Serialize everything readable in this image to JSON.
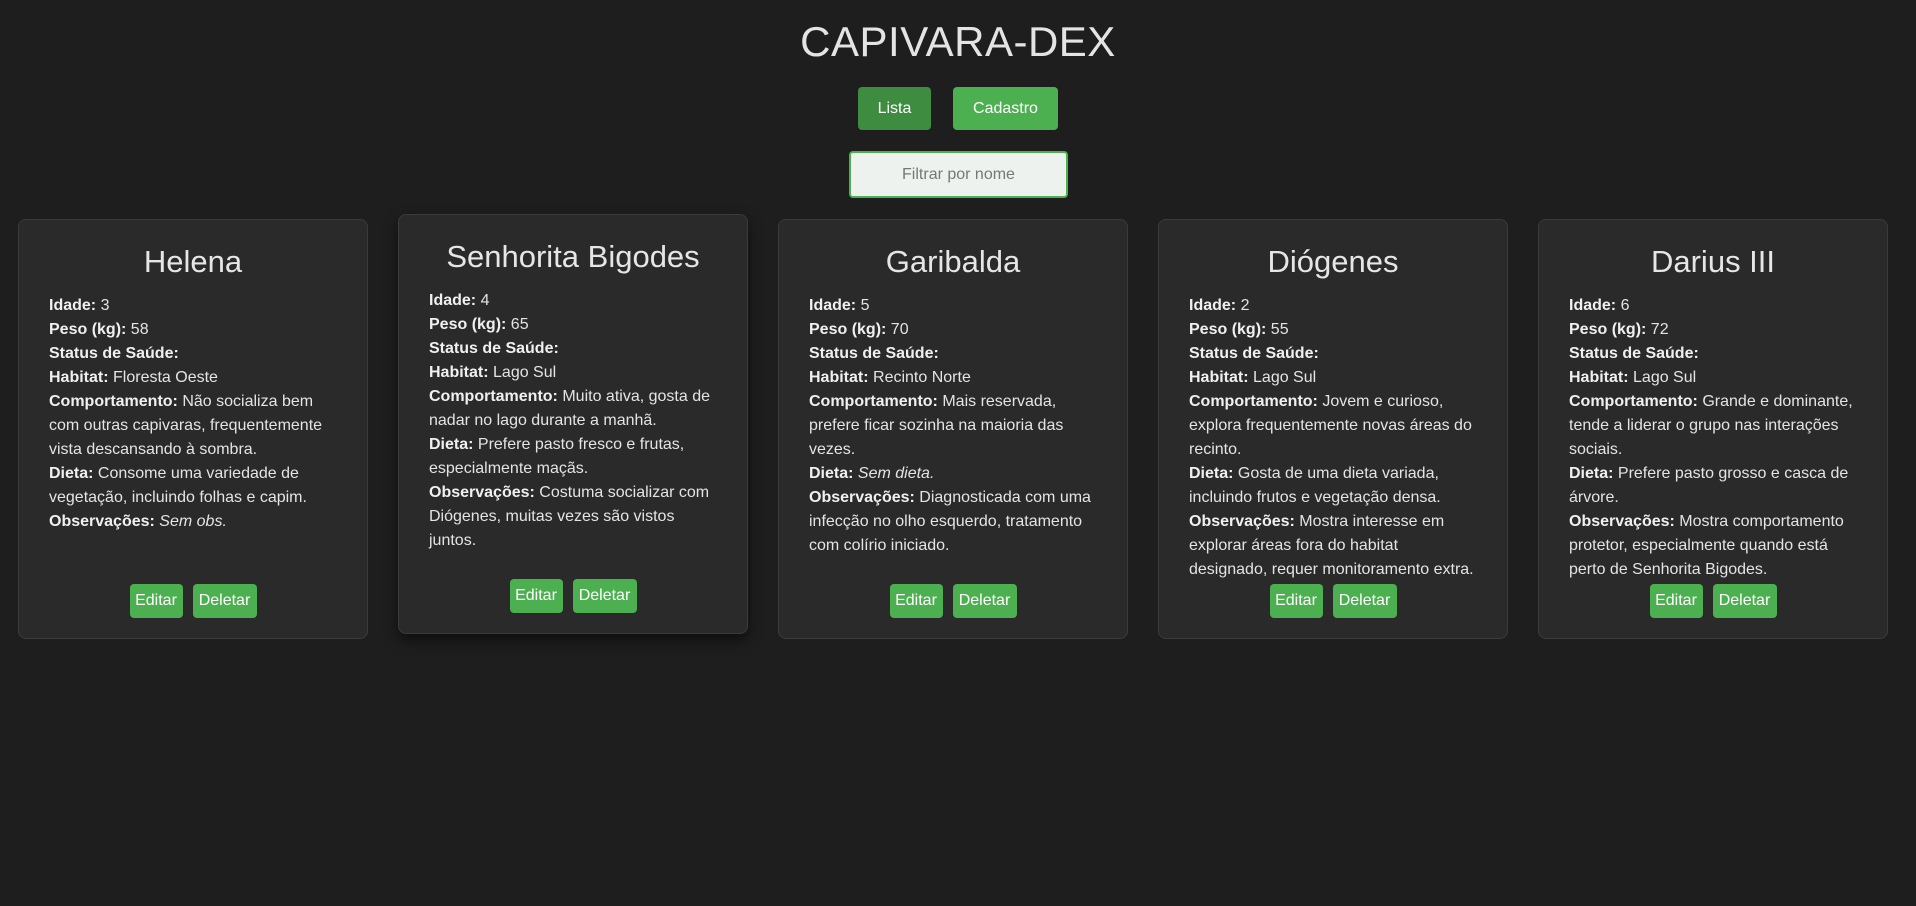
{
  "app": {
    "title": "CAPIVARA-DEX"
  },
  "nav": {
    "lista": "Lista",
    "cadastro": "Cadastro"
  },
  "filter": {
    "placeholder": "Filtrar por nome",
    "value": ""
  },
  "labels": {
    "idade": "Idade:",
    "peso": "Peso (kg):",
    "status": "Status de Saúde:",
    "habitat": "Habitat:",
    "comportamento": "Comportamento:",
    "dieta": "Dieta:",
    "observacoes": "Observações:",
    "edit": "Editar",
    "delete": "Deletar"
  },
  "colors": {
    "accent": "#4caf50",
    "background": "#1e1e1e",
    "card": "#2a2a2a"
  },
  "cards": [
    {
      "name": "Helena",
      "idade": "3",
      "peso": "58",
      "status": "",
      "habitat": "Floresta Oeste",
      "comportamento": "Não socializa bem com outras capivaras, frequentemente vista descansando à sombra.",
      "dieta": "Consome uma variedade de vegetação, incluindo folhas e capim.",
      "observacoes": "Sem obs."
    },
    {
      "name": "Senhorita Bigodes",
      "idade": "4",
      "peso": "65",
      "status": "",
      "habitat": "Lago Sul",
      "comportamento": "Muito ativa, gosta de nadar no lago durante a manhã.",
      "dieta": "Prefere pasto fresco e frutas, especialmente maçãs.",
      "observacoes": "Costuma socializar com Diógenes, muitas vezes são vistos juntos."
    },
    {
      "name": "Garibalda",
      "idade": "5",
      "peso": "70",
      "status": "",
      "habitat": "Recinto Norte",
      "comportamento": "Mais reservada, prefere ficar sozinha na maioria das vezes.",
      "dieta": "Sem dieta.",
      "observacoes": "Diagnosticada com uma infecção no olho esquerdo, tratamento com colírio iniciado."
    },
    {
      "name": "Diógenes",
      "idade": "2",
      "peso": "55",
      "status": "",
      "habitat": "Lago Sul",
      "comportamento": "Jovem e curioso, explora frequentemente novas áreas do recinto.",
      "dieta": "Gosta de uma dieta variada, incluindo frutos e vegetação densa.",
      "observacoes": "Mostra interesse em explorar áreas fora do habitat designado, requer monitoramento extra."
    },
    {
      "name": "Darius III",
      "idade": "6",
      "peso": "72",
      "status": "",
      "habitat": "Lago Sul",
      "comportamento": "Grande e dominante, tende a liderar o grupo nas interações sociais.",
      "dieta": "Prefere pasto grosso e casca de árvore.",
      "observacoes": "Mostra comportamento protetor, especialmente quando está perto de Senhorita Bigodes."
    }
  ]
}
